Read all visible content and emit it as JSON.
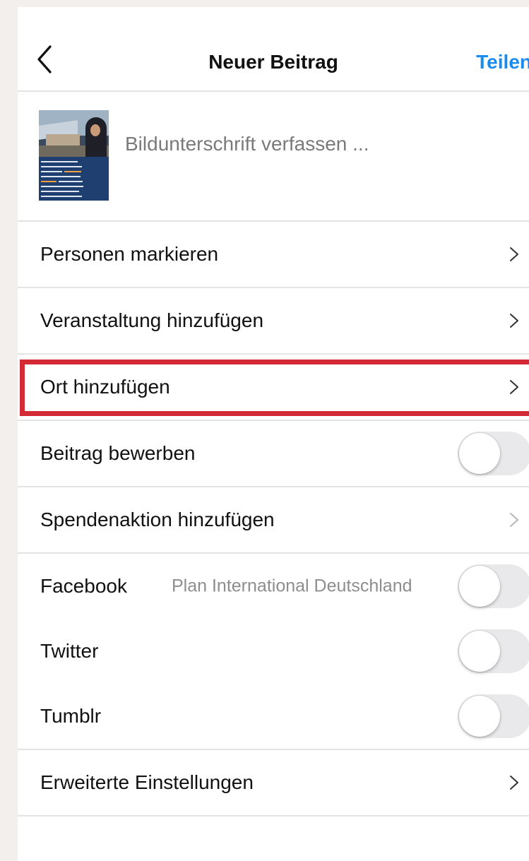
{
  "header": {
    "title": "Neuer Beitrag",
    "share_label": "Teilen",
    "back_icon": "chevron-left-icon",
    "accent_color": "#1a8cf0"
  },
  "compose": {
    "caption_placeholder": "Bildunterschrift verfassen ..."
  },
  "options": [
    {
      "label": "Personen markieren",
      "control": "chevron"
    },
    {
      "label": "Veranstaltung hinzufügen",
      "control": "chevron"
    },
    {
      "label": "Ort hinzufügen",
      "control": "chevron",
      "highlighted": true
    },
    {
      "label": "Beitrag bewerben",
      "control": "toggle",
      "on": false
    },
    {
      "label": "Spendenaktion hinzufügen",
      "control": "chevron",
      "dimmed": true
    }
  ],
  "sharing": [
    {
      "label": "Facebook",
      "account": "Plan International Deutschland",
      "on": false
    },
    {
      "label": "Twitter",
      "on": false
    },
    {
      "label": "Tumblr",
      "on": false
    }
  ],
  "advanced": {
    "label": "Erweiterte Einstellungen"
  },
  "highlight_color": "#d42a36"
}
